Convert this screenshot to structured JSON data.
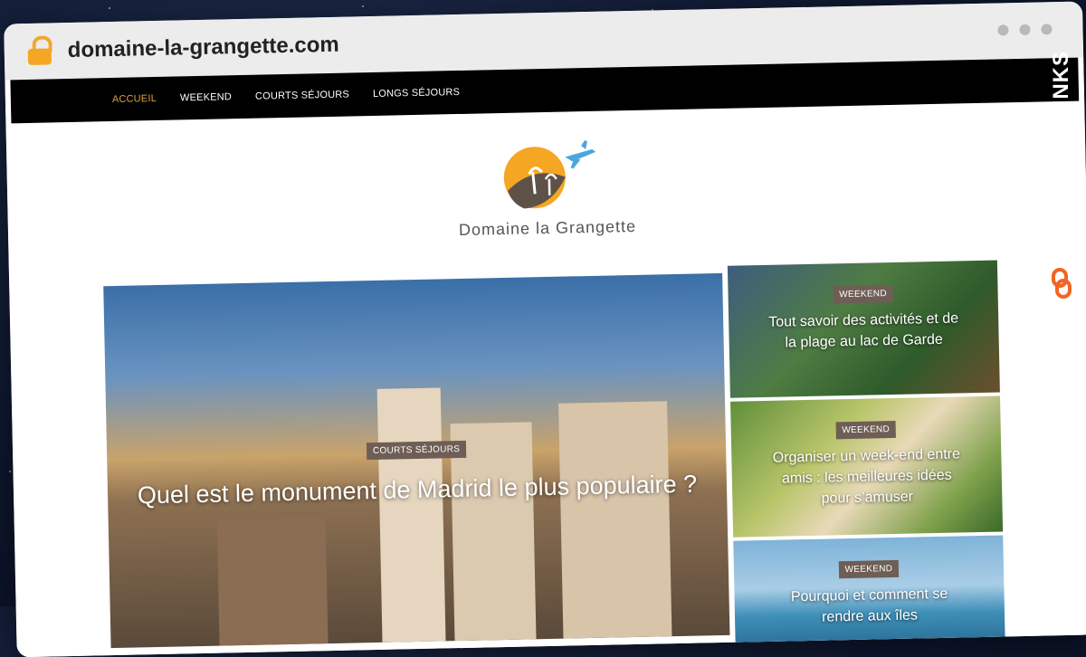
{
  "browser": {
    "url": "domaine-la-grangette.com"
  },
  "nav": {
    "items": [
      {
        "label": "ACCUEIL",
        "active": true
      },
      {
        "label": "WEEKEND"
      },
      {
        "label": "COURTS SÉJOURS"
      },
      {
        "label": "LONGS SÉJOURS"
      }
    ]
  },
  "logo": {
    "name": "Domaine la Grangette"
  },
  "hero": {
    "tag": "COURTS SÉJOURS",
    "title": "Quel est le monument de Madrid le plus populaire ?"
  },
  "side": [
    {
      "tag": "WEEKEND",
      "title": "Tout savoir des activités et de la plage au lac de Garde"
    },
    {
      "tag": "WEEKEND",
      "title": "Organiser un week-end entre amis : les meilleures idées pour s’amuser"
    },
    {
      "tag": "WEEKEND",
      "title": "Pourquoi et comment se rendre aux îles"
    }
  ],
  "watermark": {
    "text": "GUESTPOSTLINKS"
  },
  "colors": {
    "nav_bg": "#000000",
    "accent": "#e0a040",
    "tag_bg": "#6e5e55",
    "lock": "#f5a623",
    "brand": "#f26522"
  }
}
